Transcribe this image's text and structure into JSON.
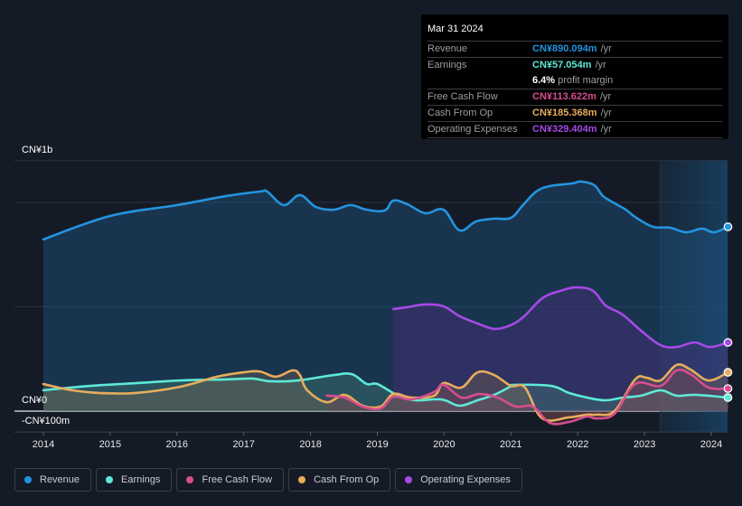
{
  "tooltip": {
    "date": "Mar 31 2024",
    "rows": [
      {
        "label": "Revenue",
        "value": "CN¥890.094m",
        "unit": "/yr",
        "color": "#2394df"
      },
      {
        "label": "Earnings",
        "value": "CN¥57.054m",
        "unit": "/yr",
        "color": "#5ee8d6"
      },
      {
        "label": "Free Cash Flow",
        "value": "CN¥113.622m",
        "unit": "/yr",
        "color": "#d64e8e"
      },
      {
        "label": "Cash From Op",
        "value": "CN¥185.368m",
        "unit": "/yr",
        "color": "#e8ad5c"
      },
      {
        "label": "Operating Expenses",
        "value": "CN¥329.404m",
        "unit": "/yr",
        "color": "#a54ae6"
      }
    ],
    "profit_margin": {
      "pct": "6.4%",
      "text": "profit margin"
    }
  },
  "legend": [
    {
      "label": "Revenue",
      "color": "#2394df"
    },
    {
      "label": "Earnings",
      "color": "#5ee8d6"
    },
    {
      "label": "Free Cash Flow",
      "color": "#d64e8e"
    },
    {
      "label": "Cash From Op",
      "color": "#e8ad5c"
    },
    {
      "label": "Operating Expenses",
      "color": "#a54ae6"
    }
  ],
  "chart_data": {
    "type": "area",
    "title": "",
    "xlabel": "",
    "ylabel": "",
    "unit": "CN¥ millions",
    "y_tick_labels": [
      "CN¥1b",
      "CN¥0",
      "-CN¥100m"
    ],
    "x_tick_labels": [
      "2014",
      "2015",
      "2016",
      "2017",
      "2018",
      "2019",
      "2020",
      "2021",
      "2022",
      "2023",
      "2024"
    ],
    "x_ticks": [
      2014,
      2015,
      2016,
      2017,
      2018,
      2019,
      2020,
      2021,
      2022,
      2023,
      2024
    ],
    "xlim": [
      2013.56,
      2024.25
    ],
    "ylim": [
      -100,
      1200
    ],
    "gridlines": [
      0,
      500,
      1000,
      1200
    ],
    "grid": true,
    "highlight_range": [
      2023.24,
      2024.25
    ],
    "series": [
      {
        "name": "Revenue",
        "color": "#2394df",
        "x": [
          2014.0,
          2015.0,
          2016.0,
          2016.73,
          2017.24,
          2017.35,
          2017.6,
          2017.84,
          2018.08,
          2018.35,
          2018.6,
          2018.84,
          2019.11,
          2019.24,
          2019.45,
          2019.72,
          2019.99,
          2020.23,
          2020.48,
          2020.75,
          2021.0,
          2021.18,
          2021.38,
          2021.58,
          2021.92,
          2022.05,
          2022.25,
          2022.38,
          2022.58,
          2022.72,
          2022.88,
          2023.13,
          2023.38,
          2023.62,
          2023.86,
          2024.04,
          2024.25
        ],
        "y": [
          823,
          935,
          987,
          1030,
          1052,
          1052,
          987,
          1035,
          978,
          965,
          987,
          965,
          961,
          1009,
          991,
          948,
          965,
          866,
          909,
          922,
          926,
          987,
          1052,
          1078,
          1091,
          1100,
          1082,
          1030,
          991,
          965,
          926,
          883,
          879,
          857,
          874,
          857,
          883
        ]
      },
      {
        "name": "Earnings",
        "color": "#5ee8d6",
        "x": [
          2014.0,
          2014.7,
          2015.38,
          2016.05,
          2016.73,
          2017.13,
          2017.4,
          2017.81,
          2018.35,
          2018.62,
          2018.84,
          2019.0,
          2019.29,
          2019.56,
          2019.96,
          2020.23,
          2020.5,
          2020.75,
          2020.99,
          2021.06,
          2021.6,
          2021.87,
          2022.14,
          2022.41,
          2022.68,
          2022.95,
          2023.24,
          2023.48,
          2023.76,
          2024.25
        ],
        "y": [
          100,
          121,
          134,
          147,
          152,
          156,
          143,
          147,
          173,
          177,
          130,
          130,
          78,
          52,
          56,
          26,
          52,
          78,
          117,
          126,
          121,
          87,
          65,
          52,
          65,
          74,
          100,
          74,
          78,
          65
        ]
      },
      {
        "name": "Free Cash Flow",
        "color": "#d64e8e",
        "x": [
          2018.24,
          2018.51,
          2018.78,
          2019.05,
          2019.24,
          2019.51,
          2019.85,
          2019.99,
          2020.26,
          2020.53,
          2020.8,
          2021.07,
          2021.33,
          2021.58,
          2021.87,
          2022.14,
          2022.28,
          2022.55,
          2022.86,
          2023.24,
          2023.48,
          2023.69,
          2023.96,
          2024.25
        ],
        "y": [
          74,
          65,
          22,
          13,
          69,
          56,
          91,
          126,
          65,
          82,
          65,
          22,
          22,
          -56,
          -52,
          -26,
          -35,
          -13,
          130,
          121,
          195,
          177,
          113,
          108
        ]
      },
      {
        "name": "Cash From Op",
        "color": "#e8ad5c",
        "x": [
          2014.0,
          2014.43,
          2014.84,
          2015.38,
          2016.05,
          2016.6,
          2017.0,
          2017.24,
          2017.48,
          2017.73,
          2017.84,
          2017.95,
          2018.24,
          2018.51,
          2018.78,
          2019.05,
          2019.24,
          2019.51,
          2019.85,
          2019.99,
          2020.26,
          2020.5,
          2020.75,
          2021.0,
          2021.21,
          2021.47,
          2021.87,
          2022.14,
          2022.28,
          2022.55,
          2022.86,
          2023.03,
          2023.24,
          2023.48,
          2023.69,
          2023.96,
          2024.25
        ],
        "y": [
          130,
          100,
          87,
          87,
          117,
          165,
          186,
          190,
          165,
          195,
          173,
          100,
          43,
          78,
          26,
          22,
          82,
          65,
          74,
          134,
          113,
          186,
          173,
          121,
          113,
          -35,
          -30,
          -17,
          -17,
          0,
          152,
          160,
          147,
          221,
          199,
          147,
          186
        ]
      },
      {
        "name": "Operating Expenses",
        "color": "#a54ae6",
        "x": [
          2019.24,
          2019.45,
          2019.72,
          2019.99,
          2020.23,
          2020.5,
          2020.75,
          2020.99,
          2021.2,
          2021.47,
          2021.74,
          2021.99,
          2022.23,
          2022.42,
          2022.67,
          2022.95,
          2023.24,
          2023.48,
          2023.75,
          2023.98,
          2024.25
        ],
        "y": [
          489,
          498,
          511,
          502,
          455,
          420,
          394,
          411,
          455,
          541,
          576,
          593,
          576,
          506,
          463,
          385,
          316,
          307,
          329,
          307,
          329
        ]
      }
    ]
  }
}
